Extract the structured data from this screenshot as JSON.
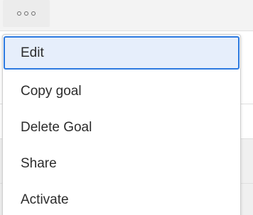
{
  "more_button": {
    "icon": "more-horizontal-icon"
  },
  "menu": {
    "items": [
      {
        "label": "Edit",
        "focused": true
      },
      {
        "label": "Copy goal"
      },
      {
        "label": "Delete Goal"
      },
      {
        "label": "Share"
      },
      {
        "label": "Activate"
      }
    ]
  },
  "colors": {
    "focus_border": "#2d7ae0",
    "focus_background": "#e6eefb",
    "text": "#2c2c2c"
  }
}
